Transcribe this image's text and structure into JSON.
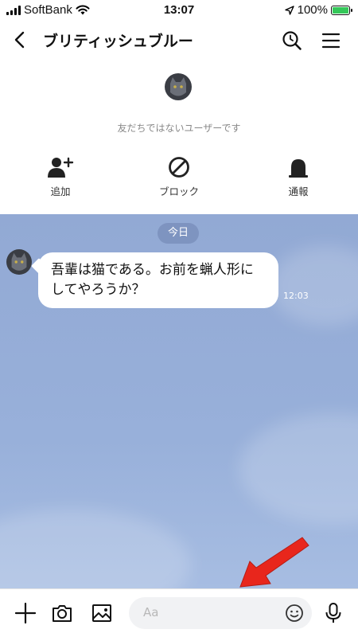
{
  "status": {
    "carrier": "SoftBank",
    "time": "13:07",
    "battery": "100%"
  },
  "header": {
    "title": "ブリティッシュブルー"
  },
  "profile": {
    "notice": "友だちではないユーザーです"
  },
  "actions": [
    {
      "label": "追加",
      "icon": "add-friend-icon"
    },
    {
      "label": "ブロック",
      "icon": "block-icon"
    },
    {
      "label": "通報",
      "icon": "report-icon"
    }
  ],
  "chat": {
    "date_label": "今日",
    "messages": [
      {
        "text": "吾輩は猫である。お前を蝋人形にしてやろうか？",
        "time": "12:03"
      }
    ]
  },
  "composer": {
    "placeholder": "Aa"
  },
  "colors": {
    "chat_bg": "#95acd6",
    "annotation_arrow": "#e8261c",
    "battery_green": "#34c759"
  }
}
